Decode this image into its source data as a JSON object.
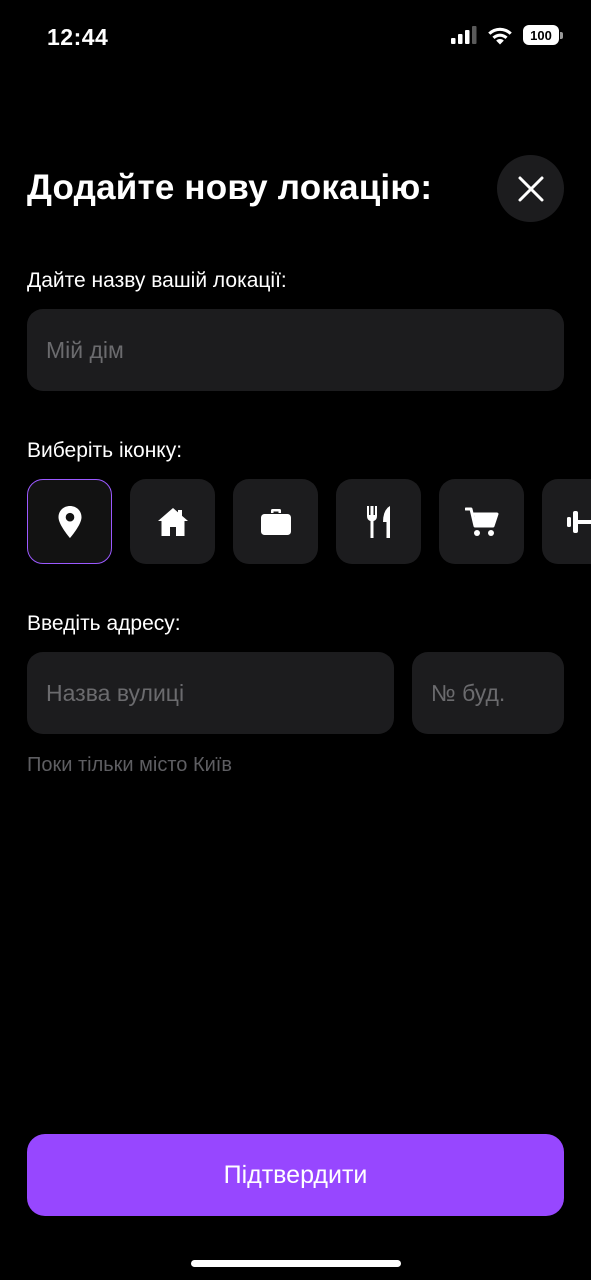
{
  "status_bar": {
    "time": "12:44",
    "battery": "100"
  },
  "header": {
    "title": "Додайте нову локацію:",
    "close_icon": "close-icon"
  },
  "name_section": {
    "label": "Дайте назву вашій локації:",
    "placeholder": "Мій дім",
    "value": ""
  },
  "icon_section": {
    "label": "Виберіть іконку:",
    "selected": "location-pin-icon",
    "icons": [
      "location-pin-icon",
      "home-icon",
      "briefcase-icon",
      "fork-knife-icon",
      "shopping-cart-icon",
      "dumbbell-icon"
    ]
  },
  "address_section": {
    "label": "Введіть адресу:",
    "street_placeholder": "Назва вулиці",
    "number_placeholder": "№ буд.",
    "hint": "Поки тільки місто Київ"
  },
  "confirm_button": {
    "label": "Підтвердити"
  },
  "colors": {
    "background": "#000000",
    "surface": "#1c1c1e",
    "accent": "#9747ff",
    "placeholder": "#6b6b6e"
  }
}
